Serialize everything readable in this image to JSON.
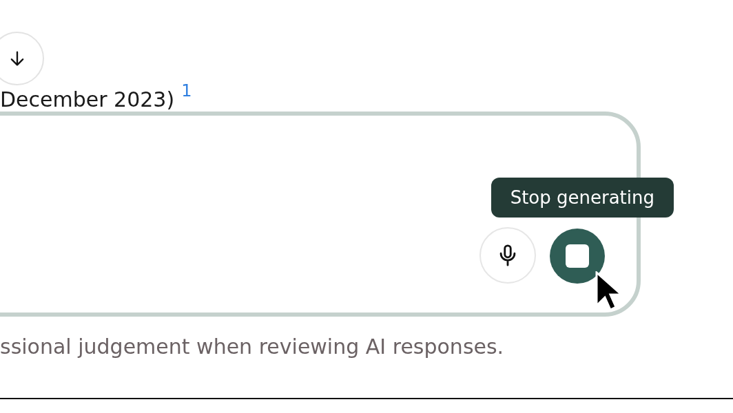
{
  "message_tail": {
    "text": "December 2023)",
    "citation": "1"
  },
  "composer": {
    "tooltip": "Stop generating",
    "generating": true
  },
  "disclaimer": "ssional judgement when reviewing AI responses."
}
